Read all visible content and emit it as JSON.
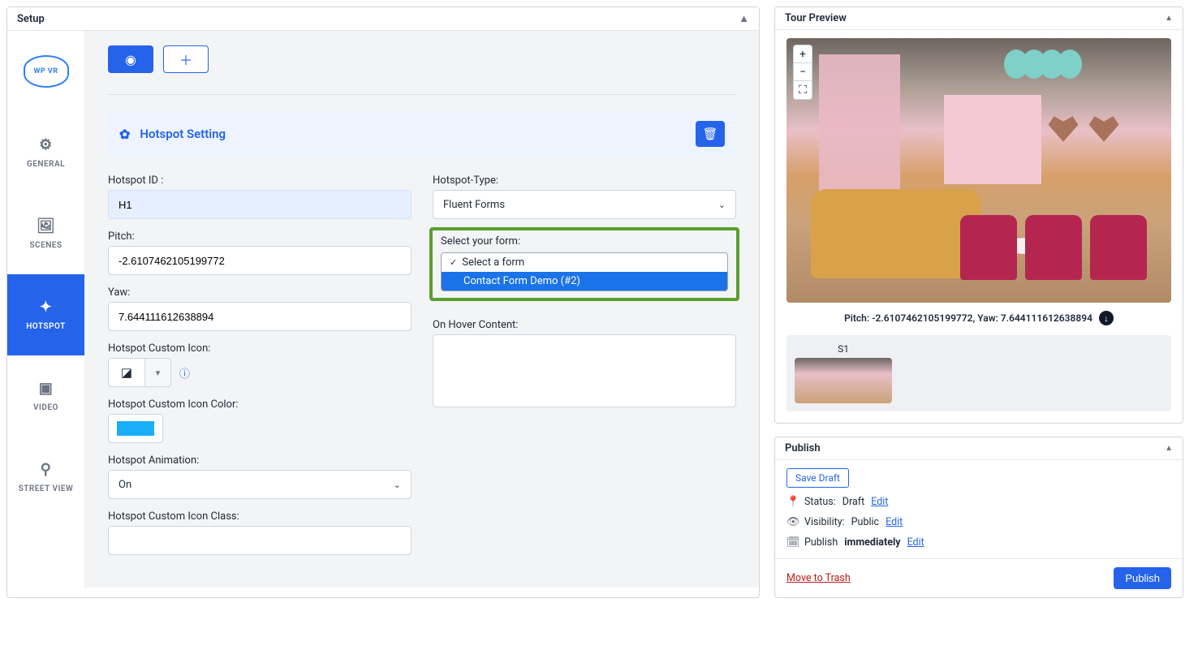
{
  "left_panel": {
    "title": "Setup"
  },
  "sidebar": {
    "logo_text": "WP VR",
    "items": [
      {
        "label": "GENERAL"
      },
      {
        "label": "SCENES"
      },
      {
        "label": "HOTSPOT"
      },
      {
        "label": "VIDEO"
      },
      {
        "label": "STREET VIEW"
      }
    ]
  },
  "hotspot": {
    "setting_title": "Hotspot Setting",
    "labels": {
      "id": "Hotspot ID :",
      "pitch": "Pitch:",
      "yaw": "Yaw:",
      "custom_icon": "Hotspot Custom Icon:",
      "custom_icon_color": "Hotspot Custom Icon Color:",
      "animation": "Hotspot Animation:",
      "custom_icon_class": "Hotspot Custom Icon Class:",
      "type": "Hotspot-Type:",
      "select_form": "Select your form:",
      "on_hover": "On Hover Content:"
    },
    "values": {
      "id": "H1",
      "pitch": "-2.6107462105199772",
      "yaw": "7.644111612638894",
      "type": "Fluent Forms",
      "animation": "On",
      "custom_icon_color": "#1aaef7",
      "custom_icon_class": ""
    },
    "form_options": [
      {
        "label": "Select a form",
        "is_placeholder": true
      },
      {
        "label": "Contact Form Demo (#2)",
        "highlighted": true
      }
    ]
  },
  "preview": {
    "title": "Tour Preview",
    "coord_text": "Pitch: -2.6107462105199772, Yaw: 7.644111612638894",
    "thumb_label": "S1",
    "zoom_plus": "+",
    "zoom_minus": "−",
    "fullscreen": "⛶"
  },
  "publish": {
    "title": "Publish",
    "save_draft": "Save Draft",
    "status_label": "Status:",
    "status_value": "Draft",
    "visibility_label": "Visibility:",
    "visibility_value": "Public",
    "publish_label": "Publish",
    "publish_value": "immediately",
    "edit": "Edit",
    "move_to_trash": "Move to Trash",
    "publish_btn": "Publish"
  }
}
